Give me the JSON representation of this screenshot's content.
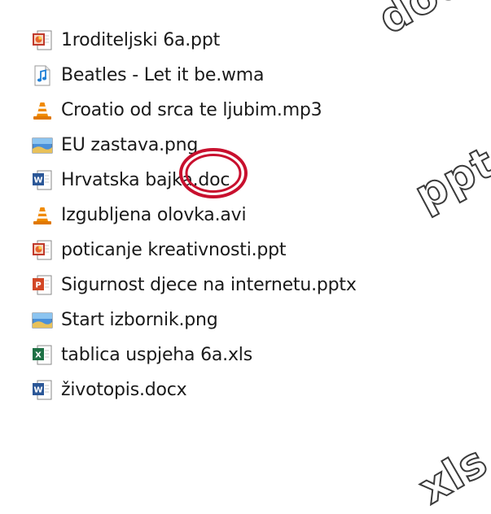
{
  "files": [
    {
      "name": "1roditeljski 6a.ppt",
      "icon": "powerpoint-97-icon"
    },
    {
      "name": "Beatles - Let it be.wma",
      "icon": "audio-file-icon"
    },
    {
      "name": "Croatio od srca te ljubim.mp3",
      "icon": "vlc-cone-icon"
    },
    {
      "name": "EU zastava.png",
      "icon": "image-file-icon"
    },
    {
      "name": "Hrvatska bajka.doc",
      "icon": "word-file-icon"
    },
    {
      "name": "Izgubljena olovka.avi",
      "icon": "vlc-cone-icon"
    },
    {
      "name": "poticanje kreativnosti.ppt",
      "icon": "powerpoint-97-icon"
    },
    {
      "name": "Sigurnost djece na internetu.pptx",
      "icon": "powerpoint-file-icon"
    },
    {
      "name": "Start izbornik.png",
      "icon": "image-file-icon"
    },
    {
      "name": "tablica uspjeha 6a.xls",
      "icon": "excel-file-icon"
    },
    {
      "name": "životopis.docx",
      "icon": "word-file-icon"
    }
  ],
  "watermarks": {
    "docx": "docx",
    "ppt": "ppt",
    "xls": "xls"
  },
  "colors": {
    "highlight": "#c8102e",
    "vlc_orange": "#f08a00",
    "word_blue": "#2b5797",
    "excel_green": "#1e7145",
    "powerpoint_red": "#d24726"
  }
}
